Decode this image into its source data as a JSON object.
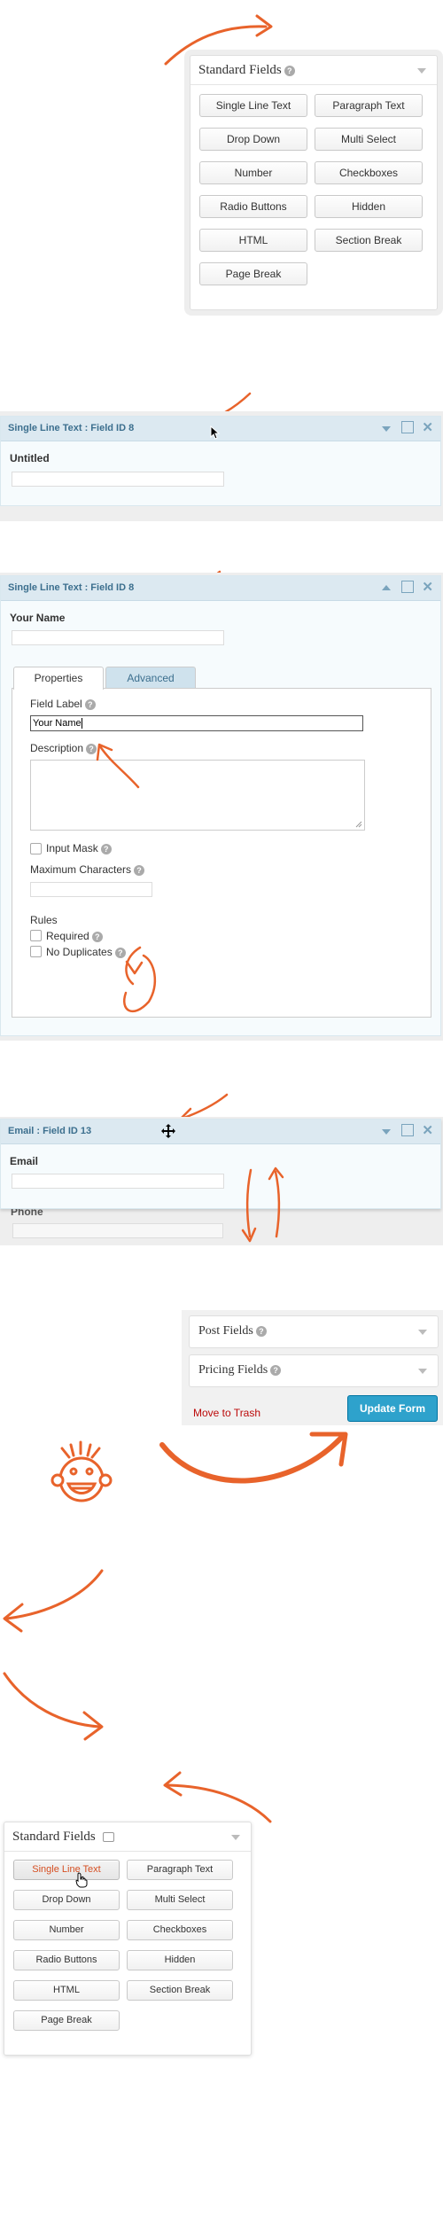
{
  "standard_fields_1": {
    "title": "Standard Fields",
    "buttons": [
      "Single Line Text",
      "Paragraph Text",
      "Drop Down",
      "Multi Select",
      "Number",
      "Checkboxes",
      "Radio Buttons",
      "Hidden",
      "HTML",
      "Section Break",
      "Page Break"
    ]
  },
  "field_panel_1": {
    "title": "Single Line Text : Field ID 8",
    "label": "Untitled"
  },
  "field_panel_2": {
    "title": "Single Line Text : Field ID 8",
    "label": "Your Name",
    "tabs": [
      "Properties",
      "Advanced"
    ],
    "field_label_caption": "Field Label",
    "field_label_value": "Your Name",
    "description_caption": "Description",
    "input_mask": "Input Mask",
    "max_chars": "Maximum Characters",
    "rules_caption": "Rules",
    "rules": [
      "Required",
      "No Duplicates"
    ]
  },
  "field_panel_3": {
    "title": "Email : Field ID 13",
    "label": "Email",
    "below_label": "Phone"
  },
  "publish": {
    "post_fields": "Post Fields",
    "pricing_fields": "Pricing Fields",
    "trash": "Move to Trash",
    "update": "Update Form"
  },
  "standard_fields_2": {
    "title": "Standard Fields",
    "buttons": [
      "Single Line Text",
      "Paragraph Text",
      "Drop Down",
      "Multi Select",
      "Number",
      "Checkboxes",
      "Radio Buttons",
      "Hidden",
      "HTML",
      "Section Break",
      "Page Break"
    ]
  },
  "colors": {
    "accent_arrow": "#e8632b",
    "update_button": "#2ea2cc",
    "trash": "#bc0b0b",
    "field_bar": "#dce9f1"
  }
}
